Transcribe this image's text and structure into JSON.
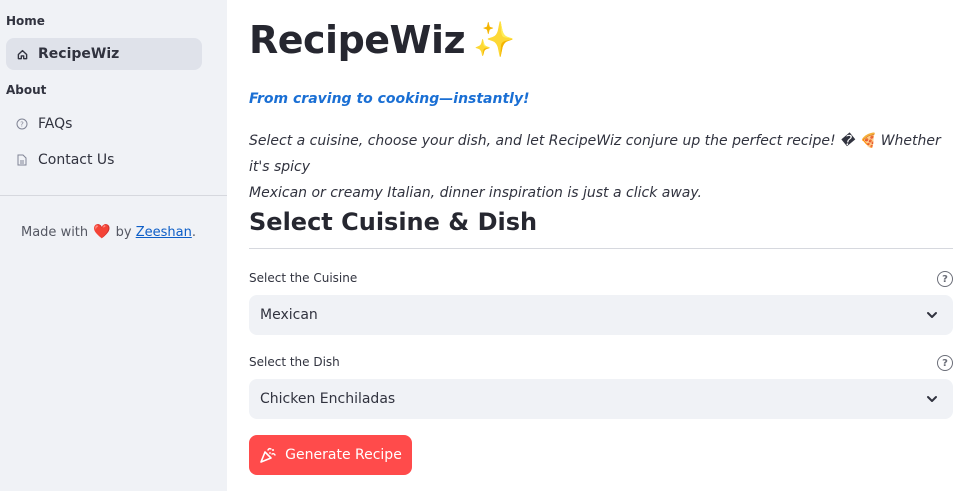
{
  "sidebar": {
    "sections": [
      {
        "label": "Home"
      },
      {
        "label": "About"
      }
    ],
    "items": [
      {
        "label": "RecipeWiz",
        "icon": "home-icon",
        "active": true
      },
      {
        "label": "FAQs",
        "icon": "help-circle-icon",
        "active": false
      },
      {
        "label": "Contact Us",
        "icon": "document-icon",
        "active": false
      }
    ],
    "footer": {
      "prefix": "Made with",
      "heart": "❤️",
      "by": "by",
      "author": "Zeeshan",
      "suffix": "."
    }
  },
  "main": {
    "title": "RecipeWiz",
    "title_emoji": "✨",
    "tagline": "From craving to cooking—instantly!",
    "intro_line1": "Select a cuisine, choose your dish, and let RecipeWiz conjure up the perfect recipe! � 🍕 Whether it's spicy",
    "intro_line2": "Mexican or creamy Italian, dinner inspiration is just a click away.",
    "section_heading": "Select Cuisine & Dish",
    "cuisine": {
      "label": "Select the Cuisine",
      "value": "Mexican"
    },
    "dish": {
      "label": "Select the Dish",
      "value": "Chicken Enchiladas"
    },
    "generate_button": "Generate Recipe"
  },
  "colors": {
    "sidebar_bg": "#f0f2f6",
    "primary": "#ff4b4b",
    "tagline": "#1a6fd4",
    "link": "#0d5ec7"
  }
}
